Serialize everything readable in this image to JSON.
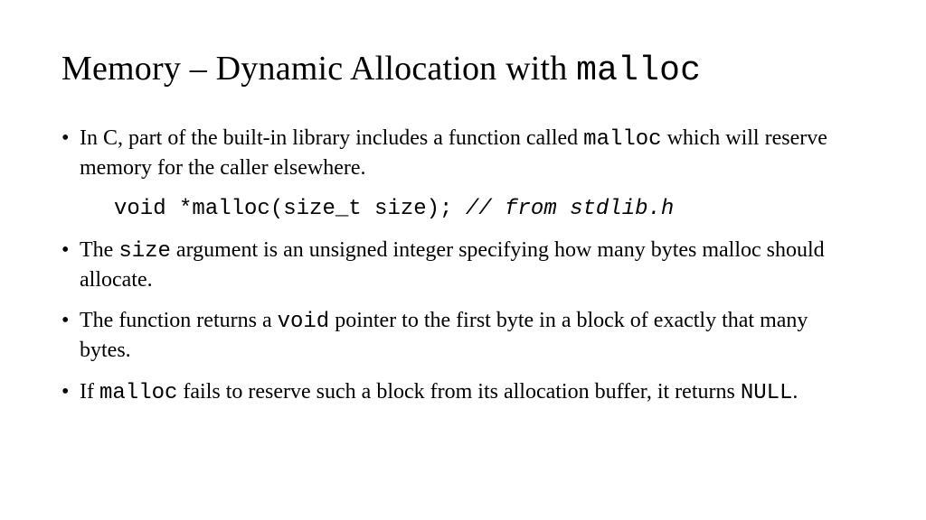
{
  "title": {
    "prefix": "Memory – Dynamic Allocation with ",
    "code": "malloc"
  },
  "bullets": {
    "b1": {
      "t1": "In C, part of the built-in library includes a function called ",
      "c1": "malloc",
      "t2": " which will reserve memory for the caller elsewhere."
    },
    "code": {
      "sig": "void *malloc(size_t size);",
      "gap": "  ",
      "comment": "// from stdlib.h"
    },
    "b2": {
      "t1": "The ",
      "c1": "size",
      "t2": " argument is an unsigned integer specifying how many bytes malloc should allocate."
    },
    "b3": {
      "t1": "The function returns a ",
      "c1": "void",
      "t2": " pointer to the first byte in a block of exactly that many bytes."
    },
    "b4": {
      "t1": "If ",
      "c1": "malloc",
      "t2": " fails to reserve such a block from its allocation buffer, it returns ",
      "c2": "NULL",
      "t3": "."
    }
  }
}
